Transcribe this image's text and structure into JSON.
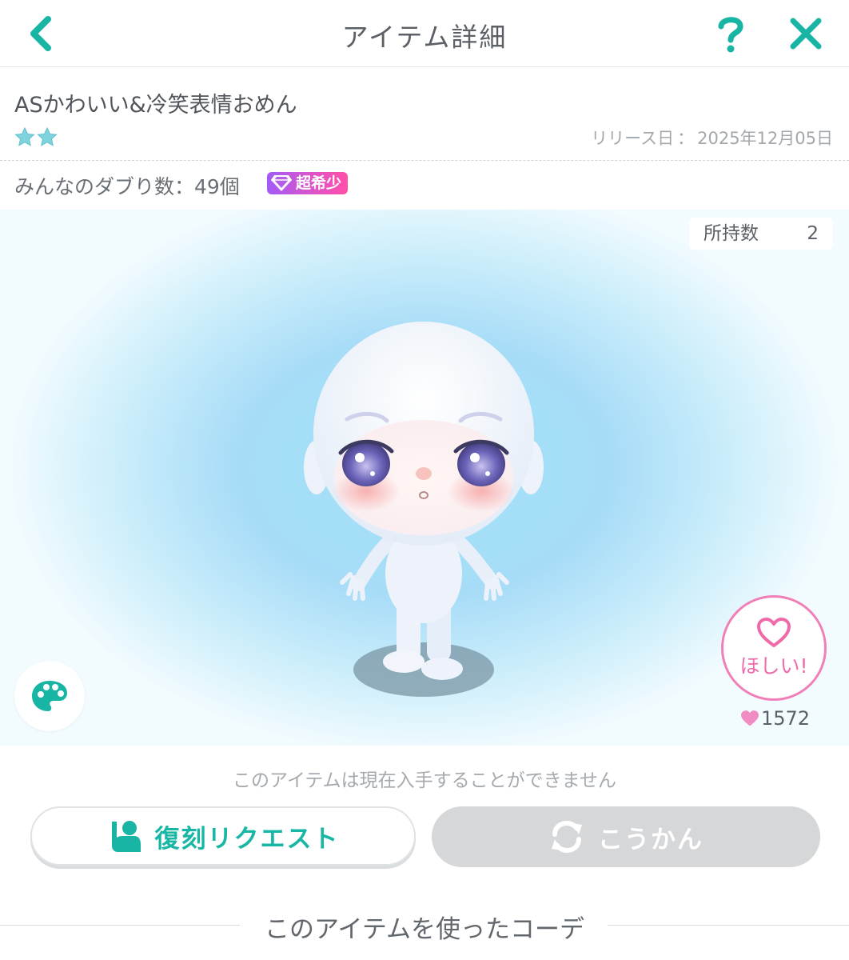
{
  "header": {
    "title": "アイテム詳細",
    "back_icon": "chevron-left-icon",
    "help_icon": "question-icon",
    "close_icon": "close-icon",
    "accent_color": "#19b5a4"
  },
  "item": {
    "name": "ASかわいい&冷笑表情おめん",
    "star_count": 2,
    "release_label": "リリース日",
    "release_sep": "：",
    "release_date": "2025年12月05日"
  },
  "duplicates": {
    "label": "みんなのダブり数：49個",
    "rarity_badge": "超希少",
    "badge_icon": "diamond-icon"
  },
  "stage": {
    "owned_label": "所持数",
    "owned_count": "2",
    "palette_icon": "palette-icon",
    "want_label": "ほしい!",
    "want_icon": "heart-outline-icon",
    "like_icon": "heart-icon",
    "like_count": "1572"
  },
  "actions": {
    "unavailable_text": "このアイテムは現在入手することができません",
    "request_label": "復刻リクエスト",
    "request_icon": "raise-hand-icon",
    "exchange_label": "こうかん",
    "exchange_icon": "exchange-icon",
    "exchange_color": "#d6d7d9"
  },
  "section": {
    "coordinate_title": "このアイテムを使ったコーデ"
  }
}
